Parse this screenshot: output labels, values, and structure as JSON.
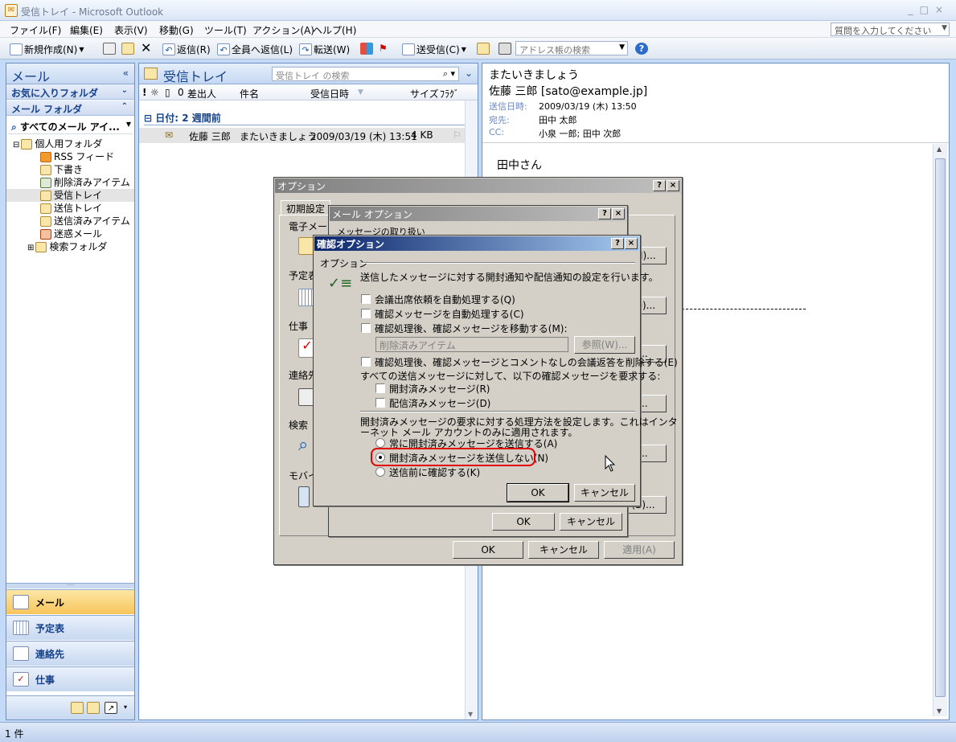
{
  "window": {
    "title": "受信トレイ - Microsoft Outlook",
    "min": "_",
    "max": "□",
    "close": "×"
  },
  "menu": {
    "items": [
      "ファイル(F)",
      "編集(E)",
      "表示(V)",
      "移動(G)",
      "ツール(T)",
      "アクション(A)",
      "ヘルプ(H)"
    ],
    "help_placeholder": "質問を入力してください"
  },
  "toolbar": {
    "new": "新規作成(N)",
    "reply": "返信(R)",
    "reply_all": "全員へ返信(L)",
    "forward": "転送(W)",
    "send_receive": "送受信(C)",
    "address_search": "アドレス帳の検索"
  },
  "nav": {
    "title": "メール",
    "favorites": "お気に入りフォルダ",
    "mail_folders": "メール フォルダ",
    "all_items": "すべてのメール アイ...",
    "tree": [
      {
        "label": "個人用フォルダ",
        "level": 0,
        "selected": false
      },
      {
        "label": "RSS フィード",
        "level": 1,
        "selected": false
      },
      {
        "label": "下書き",
        "level": 1,
        "selected": false
      },
      {
        "label": "削除済みアイテム",
        "level": 1,
        "selected": false
      },
      {
        "label": "受信トレイ",
        "level": 1,
        "selected": true
      },
      {
        "label": "送信トレイ",
        "level": 1,
        "selected": false
      },
      {
        "label": "送信済みアイテム",
        "level": 1,
        "selected": false
      },
      {
        "label": "迷惑メール",
        "level": 1,
        "selected": false
      },
      {
        "label": "検索フォルダ",
        "level": 1,
        "selected": false
      }
    ],
    "buttons": [
      "メール",
      "予定表",
      "連絡先",
      "仕事"
    ]
  },
  "inbox": {
    "title": "受信トレイ",
    "search_placeholder": "受信トレイ の検索",
    "columns": {
      "from": "差出人",
      "subject": "件名",
      "received": "受信日時",
      "size": "サイズ",
      "flag": "ﾌﾗｸﾞ"
    },
    "group": "日付: 2 週間前",
    "message": {
      "from": "佐藤 三郎",
      "subject": "またいきましょう",
      "received": "2009/03/19 (木) 13:51",
      "size": "4 KB"
    }
  },
  "reading": {
    "subject": "またいきましょう",
    "from": "佐藤 三郎 [sato@example.jp]",
    "sent_label": "送信日時:",
    "sent_value": "2009/03/19 (木) 13:50",
    "to_label": "宛先:",
    "to_value": "田中 太郎",
    "cc_label": "CC:",
    "cc_value": "小泉 一郎; 田中 次郎",
    "greeting": "田中さん"
  },
  "status": {
    "count": "1 件"
  },
  "options_dialog": {
    "title": "オプション",
    "tab_first": "初期設定",
    "side_labels": [
      "電子メール",
      "予定表",
      "仕事",
      "連絡先",
      "検索",
      "モバイル"
    ],
    "ok": "OK",
    "cancel": "キャンセル",
    "apply": "適用(A)",
    "right_buttons": [
      "(M)...",
      "(O)...",
      "...",
      "...",
      "...",
      "(B)..."
    ]
  },
  "mail_options_dialog": {
    "title": "メール オプション",
    "section": "メッセージの取り扱い",
    "ok": "OK",
    "cancel": "キャンセル"
  },
  "tracking_dialog": {
    "title": "確認オプション",
    "group": "オプション",
    "desc": "送信したメッセージに対する開封通知や配信通知の設定を行います。",
    "opt1": "会議出席依頼を自動処理する(Q)",
    "opt2": "確認メッセージを自動処理する(C)",
    "opt3": "確認処理後、確認メッセージを移動する(M):",
    "folder": "削除済みアイテム",
    "browse": "参照(W)...",
    "opt4": "確認処理後、確認メッセージとコメントなしの会議返答を削除する(E)",
    "request_label": "すべての送信メッセージに対して、以下の確認メッセージを要求する:",
    "read_receipt": "開封済みメッセージ(R)",
    "delivery_receipt": "配信済みメッセージ(D)",
    "handling_line1": "開封済みメッセージの要求に対する処理方法を設定します。これはインタ",
    "handling_line2": "ーネット メール アカウントのみに適用されます。",
    "radio_always": "常に開封済みメッセージを送信する(A)",
    "radio_never": "開封済みメッセージを送信しない(N)",
    "radio_ask": "送信前に確認する(K)",
    "ok": "OK",
    "cancel": "キャンセル"
  }
}
